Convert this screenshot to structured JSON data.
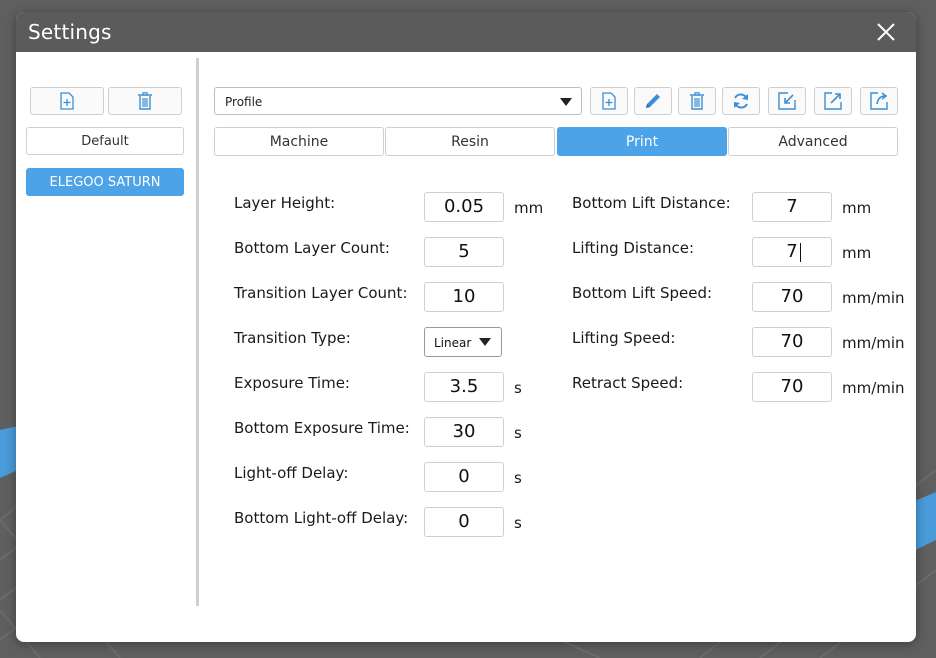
{
  "window": {
    "title": "Settings"
  },
  "left_panel": {
    "presets": [
      {
        "label": "Default",
        "selected": false
      },
      {
        "label": "ELEGOO SATURN",
        "selected": true
      }
    ]
  },
  "profile": {
    "selected": "Profile"
  },
  "tabs": [
    {
      "label": "Machine",
      "active": false
    },
    {
      "label": "Resin",
      "active": false
    },
    {
      "label": "Print",
      "active": true
    },
    {
      "label": "Advanced",
      "active": false
    }
  ],
  "print_left": {
    "layer_height": {
      "label": "Layer Height:",
      "value": "0.05",
      "unit": "mm"
    },
    "bottom_layer_count": {
      "label": "Bottom Layer Count:",
      "value": "5"
    },
    "transition_layer_count": {
      "label": "Transition Layer Count:",
      "value": "10"
    },
    "transition_type": {
      "label": "Transition Type:",
      "value": "Linear"
    },
    "exposure_time": {
      "label": "Exposure Time:",
      "value": "3.5",
      "unit": "s"
    },
    "bottom_exposure_time": {
      "label": "Bottom Exposure Time:",
      "value": "30",
      "unit": "s"
    },
    "light_off_delay": {
      "label": "Light-off Delay:",
      "value": "0",
      "unit": "s"
    },
    "bottom_light_off_delay": {
      "label": "Bottom Light-off Delay:",
      "value": "0",
      "unit": "s"
    }
  },
  "print_right": {
    "bottom_lift_distance": {
      "label": "Bottom Lift Distance:",
      "value": "7",
      "unit": "mm"
    },
    "lifting_distance": {
      "label": "Lifting Distance:",
      "value": "7",
      "unit": "mm"
    },
    "bottom_lift_speed": {
      "label": "Bottom Lift Speed:",
      "value": "70",
      "unit": "mm/min"
    },
    "lifting_speed": {
      "label": "Lifting Speed:",
      "value": "70",
      "unit": "mm/min"
    },
    "retract_speed": {
      "label": "Retract Speed:",
      "value": "70",
      "unit": "mm/min"
    }
  },
  "colors": {
    "accent": "#4da3e8",
    "titlebar": "#5b5b5b",
    "backdrop": "#5f5f5f",
    "plate_blue": "#4a9bd9"
  },
  "icons": [
    "new-file-icon",
    "trash-icon",
    "edit-pencil-icon",
    "refresh-icon",
    "import-icon",
    "export-icon",
    "export-all-icon",
    "close-icon"
  ]
}
